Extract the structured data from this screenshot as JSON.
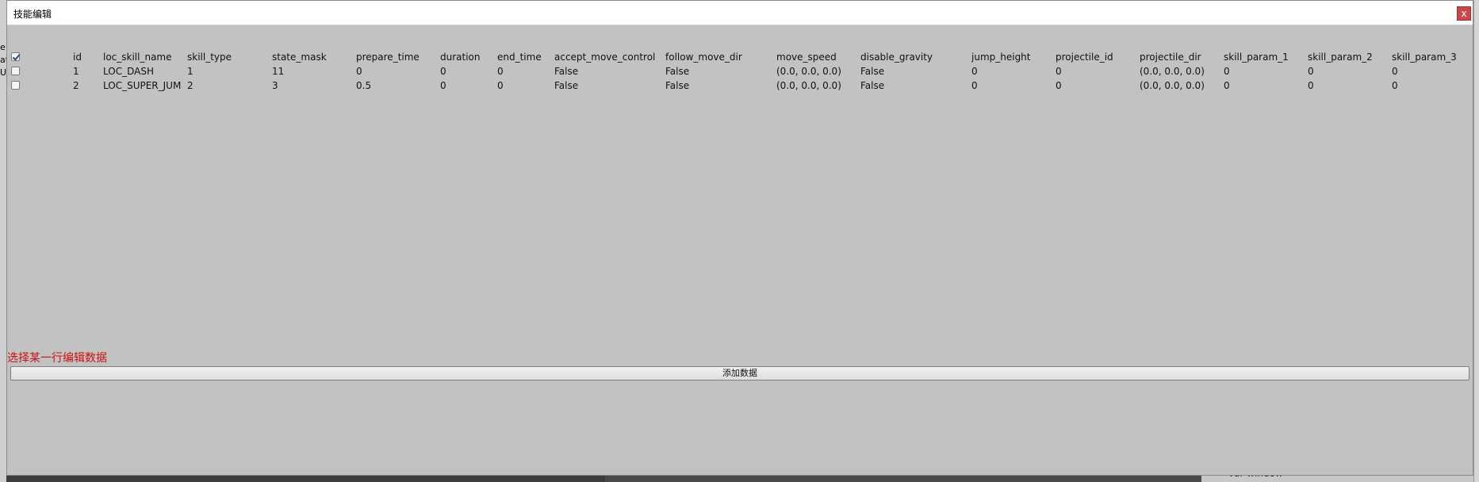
{
  "dialog": {
    "title": "技能编辑",
    "close_label": "x"
  },
  "table": {
    "header_checked": true,
    "columns": [
      "id",
      "loc_skill_name",
      "skill_type",
      "state_mask",
      "prepare_time",
      "duration",
      "end_time",
      "accept_move_control",
      "follow_move_dir",
      "move_speed",
      "disable_gravity",
      "jump_height",
      "projectile_id",
      "projectile_dir",
      "skill_param_1",
      "skill_param_2",
      "skill_param_3"
    ],
    "rows": [
      {
        "checked": false,
        "cells": [
          "1",
          "LOC_DASH",
          "1",
          "11",
          "0",
          "0",
          "0",
          "False",
          "False",
          "(0.0, 0.0, 0.0)",
          "False",
          "0",
          "0",
          "(0.0, 0.0, 0.0)",
          "0",
          "0",
          "0"
        ]
      },
      {
        "checked": false,
        "cells": [
          "2",
          "LOC_SUPER_JUM",
          "2",
          "3",
          "0.5",
          "0",
          "0",
          "False",
          "False",
          "(0.0, 0.0, 0.0)",
          "False",
          "0",
          "0",
          "(0.0, 0.0, 0.0)",
          "0",
          "0",
          "0"
        ]
      }
    ]
  },
  "hint": "选择某一行编辑数据",
  "add_button_label": "添加数据",
  "background": {
    "code_text": "var window =",
    "left_text": [
      "e",
      "at",
      "U"
    ]
  }
}
